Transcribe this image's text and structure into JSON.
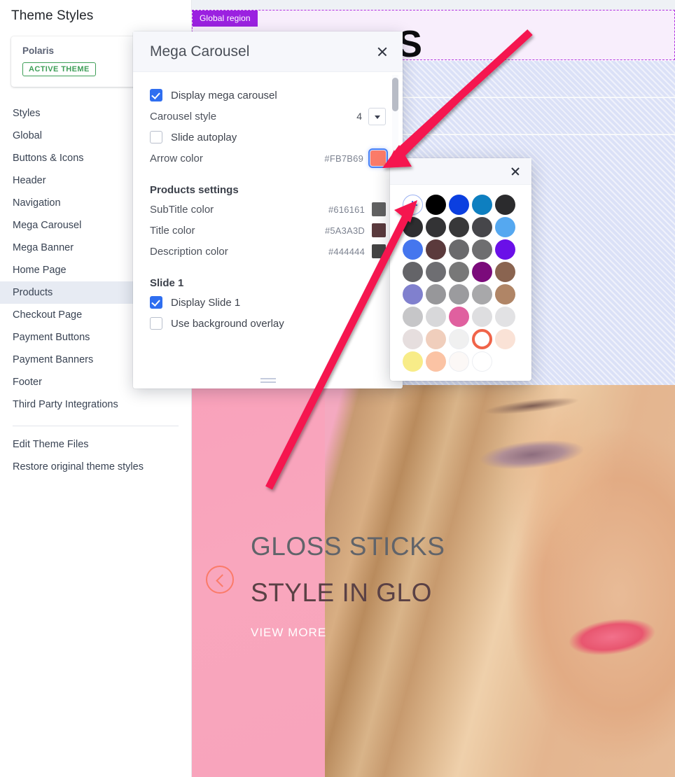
{
  "sidebar": {
    "title": "Theme Styles",
    "theme": {
      "name": "Polaris",
      "badge": "ACTIVE THEME"
    },
    "items": [
      {
        "label": "Styles",
        "active": false
      },
      {
        "label": "Global",
        "active": false
      },
      {
        "label": "Buttons & Icons",
        "active": false
      },
      {
        "label": "Header",
        "active": false
      },
      {
        "label": "Navigation",
        "active": false
      },
      {
        "label": "Mega Carousel",
        "active": false
      },
      {
        "label": "Mega Banner",
        "active": false
      },
      {
        "label": "Home Page",
        "active": false
      },
      {
        "label": "Products",
        "active": true
      },
      {
        "label": "Checkout Page",
        "active": false
      },
      {
        "label": "Payment Buttons",
        "active": false
      },
      {
        "label": "Payment Banners",
        "active": false
      },
      {
        "label": "Footer",
        "active": false
      },
      {
        "label": "Third Party Integrations",
        "active": false
      }
    ],
    "actions": [
      {
        "label": "Edit Theme Files"
      },
      {
        "label": "Restore original theme styles"
      }
    ]
  },
  "preview": {
    "region_badge": "Global region",
    "hero_letter": "S",
    "slide": {
      "subtitle": "GLOSS STICKS",
      "title": "STYLE IN GLO",
      "cta": "VIEW MORE",
      "prev_icon": "chevron-left-icon"
    }
  },
  "modal": {
    "title": "Mega Carousel",
    "close_icon": "close-icon",
    "display_carousel": {
      "label": "Display mega carousel",
      "checked": true
    },
    "carousel_style": {
      "label": "Carousel style",
      "value": "4",
      "dropdown_icon": "chevron-down-icon"
    },
    "slide_autoplay": {
      "label": "Slide autoplay",
      "checked": false
    },
    "arrow_color": {
      "label": "Arrow color",
      "hex": "#FB7B69",
      "selected": true
    },
    "products_section": {
      "heading": "Products settings",
      "rows": [
        {
          "label": "SubTitle color",
          "hex": "#616161"
        },
        {
          "label": "Title color",
          "hex": "#5A3A3D"
        },
        {
          "label": "Description color",
          "hex": "#444444"
        }
      ]
    },
    "slide_section": {
      "heading": "Slide 1",
      "display_slide": {
        "label": "Display Slide 1",
        "checked": true
      },
      "background_overlay": {
        "label": "Use background overlay",
        "checked": false
      }
    },
    "resize_handle": "resize-grip-icon",
    "scrollbar": "vertical-scrollbar"
  },
  "color_picker": {
    "close_icon": "close-icon",
    "add_custom_label": "+",
    "selected_hex": "#FB7B69",
    "swatches": [
      "ADD",
      "#000000",
      "#0B3FE0",
      "#0E7FC0",
      "#2B2B2D",
      "#2E2E30",
      "#333335",
      "#383839",
      "#46464A",
      "#55A8F0",
      "#4576EE",
      "#5B3A3C",
      "#6A6A6C",
      "#6E6E70",
      "#6A10E8",
      "#646468",
      "#6E6E72",
      "#787878",
      "#7B0B7B",
      "#8A6450",
      "#8080CE",
      "#97979A",
      "#9B9B9E",
      "#A8A8AA",
      "#B08566",
      "#C6C6C8",
      "#D8D8DA",
      "#E0609F",
      "#DEDEE0",
      "#E2E2E4",
      "#E6DEDE",
      "#F0CEBC",
      "#F0F0F0",
      "#FB7B69",
      "#FAE2D6",
      "#F8EC88",
      "#FBC3A4",
      "#FCF8F6",
      "#FFFFFF"
    ]
  },
  "annotations": {
    "arrow_1": "arrow-pointing-to-arrow-color-swatch",
    "arrow_2": "arrow-pointing-to-add-custom-color",
    "color": "#F5134F"
  }
}
